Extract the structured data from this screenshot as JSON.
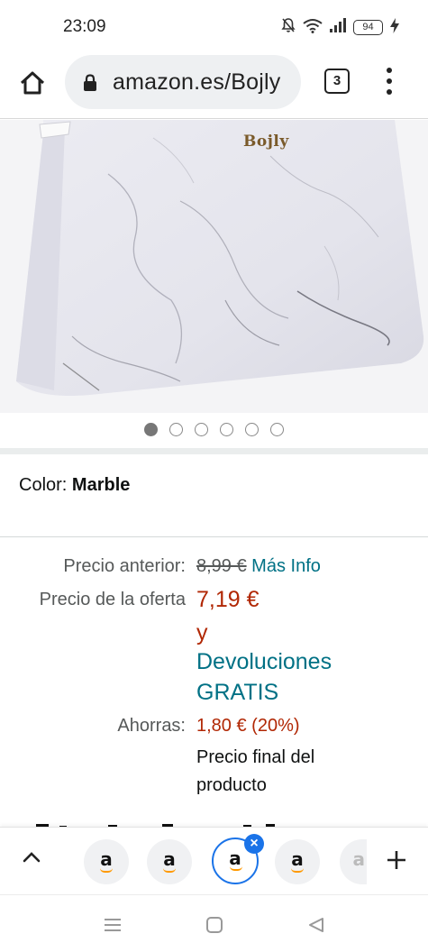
{
  "status_bar": {
    "time": "23:09",
    "battery": "94",
    "icons": [
      "mute-bell-icon",
      "wifi-icon",
      "signal-icon",
      "battery-icon",
      "charging-icon"
    ]
  },
  "browser": {
    "url": "amazon.es/Bojly",
    "tab_count": "3",
    "icons": [
      "home-icon",
      "lock-icon",
      "menu-icon"
    ]
  },
  "product": {
    "brand_on_image": "Bojly",
    "carousel": {
      "total": 6,
      "active_index": 0
    },
    "color_label": "Color:",
    "color_value": "Marble"
  },
  "pricing": {
    "previous_price_label": "Precio anterior:",
    "previous_price": "8,99 €",
    "more_info": "Más Info",
    "deal_price_label": "Precio de la oferta",
    "deal_price": "7,19 €",
    "and_word": "y",
    "free_returns_line1": "Devoluciones",
    "free_returns_line2": "GRATIS",
    "savings_label": "Ahorras:",
    "savings_value": "1,80 € (20%)",
    "final_price_line1": "Precio final del",
    "final_price_line2": "producto"
  },
  "tab_strip": {
    "tab_letter": "a",
    "tabs": [
      "tab-1",
      "tab-2",
      "tab-3-active",
      "tab-4",
      "tab-5"
    ]
  },
  "colors": {
    "deal_red": "#b12704",
    "link_teal": "#007185",
    "active_tab_blue": "#1a73e8",
    "amazon_orange": "#ff9900"
  }
}
